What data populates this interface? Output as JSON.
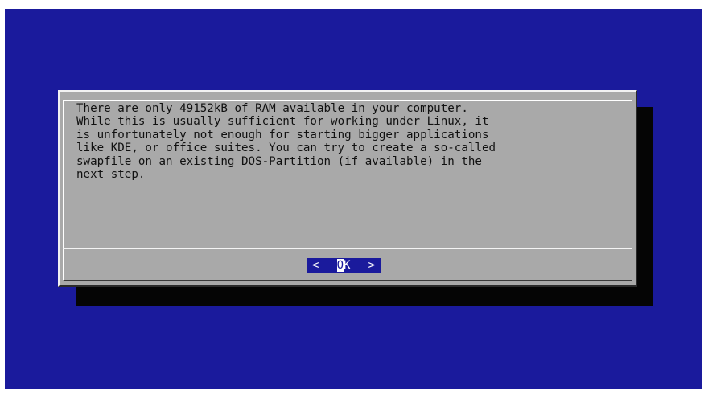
{
  "message": {
    "lines": [
      "There are only 49152kB of RAM available in your computer.",
      "While this is usually sufficient for working under Linux, it",
      "is unfortunately not enough for starting bigger applications",
      "like KDE, or office suites. You can try to create a so-called",
      "swapfile on an existing DOS-Partition (if available) in the",
      "next step."
    ]
  },
  "ok_button": {
    "left_bracket": "<",
    "hotkey": "O",
    "rest": "K",
    "right_bracket": ">"
  },
  "colors": {
    "screen_background": "#1a1a9c",
    "dialog_background": "#a9a9a9",
    "shadow": "#050505",
    "button_background": "#1a1a9c",
    "button_text": "#ffffff"
  }
}
